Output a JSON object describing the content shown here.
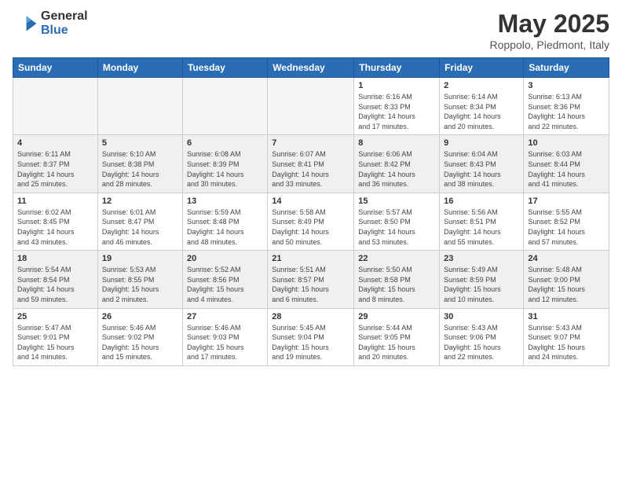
{
  "logo": {
    "general": "General",
    "blue": "Blue"
  },
  "header": {
    "title": "May 2025",
    "subtitle": "Roppolo, Piedmont, Italy"
  },
  "weekdays": [
    "Sunday",
    "Monday",
    "Tuesday",
    "Wednesday",
    "Thursday",
    "Friday",
    "Saturday"
  ],
  "weeks": [
    [
      {
        "day": "",
        "info": ""
      },
      {
        "day": "",
        "info": ""
      },
      {
        "day": "",
        "info": ""
      },
      {
        "day": "",
        "info": ""
      },
      {
        "day": "1",
        "info": "Sunrise: 6:16 AM\nSunset: 8:33 PM\nDaylight: 14 hours\nand 17 minutes."
      },
      {
        "day": "2",
        "info": "Sunrise: 6:14 AM\nSunset: 8:34 PM\nDaylight: 14 hours\nand 20 minutes."
      },
      {
        "day": "3",
        "info": "Sunrise: 6:13 AM\nSunset: 8:36 PM\nDaylight: 14 hours\nand 22 minutes."
      }
    ],
    [
      {
        "day": "4",
        "info": "Sunrise: 6:11 AM\nSunset: 8:37 PM\nDaylight: 14 hours\nand 25 minutes."
      },
      {
        "day": "5",
        "info": "Sunrise: 6:10 AM\nSunset: 8:38 PM\nDaylight: 14 hours\nand 28 minutes."
      },
      {
        "day": "6",
        "info": "Sunrise: 6:08 AM\nSunset: 8:39 PM\nDaylight: 14 hours\nand 30 minutes."
      },
      {
        "day": "7",
        "info": "Sunrise: 6:07 AM\nSunset: 8:41 PM\nDaylight: 14 hours\nand 33 minutes."
      },
      {
        "day": "8",
        "info": "Sunrise: 6:06 AM\nSunset: 8:42 PM\nDaylight: 14 hours\nand 36 minutes."
      },
      {
        "day": "9",
        "info": "Sunrise: 6:04 AM\nSunset: 8:43 PM\nDaylight: 14 hours\nand 38 minutes."
      },
      {
        "day": "10",
        "info": "Sunrise: 6:03 AM\nSunset: 8:44 PM\nDaylight: 14 hours\nand 41 minutes."
      }
    ],
    [
      {
        "day": "11",
        "info": "Sunrise: 6:02 AM\nSunset: 8:45 PM\nDaylight: 14 hours\nand 43 minutes."
      },
      {
        "day": "12",
        "info": "Sunrise: 6:01 AM\nSunset: 8:47 PM\nDaylight: 14 hours\nand 46 minutes."
      },
      {
        "day": "13",
        "info": "Sunrise: 5:59 AM\nSunset: 8:48 PM\nDaylight: 14 hours\nand 48 minutes."
      },
      {
        "day": "14",
        "info": "Sunrise: 5:58 AM\nSunset: 8:49 PM\nDaylight: 14 hours\nand 50 minutes."
      },
      {
        "day": "15",
        "info": "Sunrise: 5:57 AM\nSunset: 8:50 PM\nDaylight: 14 hours\nand 53 minutes."
      },
      {
        "day": "16",
        "info": "Sunrise: 5:56 AM\nSunset: 8:51 PM\nDaylight: 14 hours\nand 55 minutes."
      },
      {
        "day": "17",
        "info": "Sunrise: 5:55 AM\nSunset: 8:52 PM\nDaylight: 14 hours\nand 57 minutes."
      }
    ],
    [
      {
        "day": "18",
        "info": "Sunrise: 5:54 AM\nSunset: 8:54 PM\nDaylight: 14 hours\nand 59 minutes."
      },
      {
        "day": "19",
        "info": "Sunrise: 5:53 AM\nSunset: 8:55 PM\nDaylight: 15 hours\nand 2 minutes."
      },
      {
        "day": "20",
        "info": "Sunrise: 5:52 AM\nSunset: 8:56 PM\nDaylight: 15 hours\nand 4 minutes."
      },
      {
        "day": "21",
        "info": "Sunrise: 5:51 AM\nSunset: 8:57 PM\nDaylight: 15 hours\nand 6 minutes."
      },
      {
        "day": "22",
        "info": "Sunrise: 5:50 AM\nSunset: 8:58 PM\nDaylight: 15 hours\nand 8 minutes."
      },
      {
        "day": "23",
        "info": "Sunrise: 5:49 AM\nSunset: 8:59 PM\nDaylight: 15 hours\nand 10 minutes."
      },
      {
        "day": "24",
        "info": "Sunrise: 5:48 AM\nSunset: 9:00 PM\nDaylight: 15 hours\nand 12 minutes."
      }
    ],
    [
      {
        "day": "25",
        "info": "Sunrise: 5:47 AM\nSunset: 9:01 PM\nDaylight: 15 hours\nand 14 minutes."
      },
      {
        "day": "26",
        "info": "Sunrise: 5:46 AM\nSunset: 9:02 PM\nDaylight: 15 hours\nand 15 minutes."
      },
      {
        "day": "27",
        "info": "Sunrise: 5:46 AM\nSunset: 9:03 PM\nDaylight: 15 hours\nand 17 minutes."
      },
      {
        "day": "28",
        "info": "Sunrise: 5:45 AM\nSunset: 9:04 PM\nDaylight: 15 hours\nand 19 minutes."
      },
      {
        "day": "29",
        "info": "Sunrise: 5:44 AM\nSunset: 9:05 PM\nDaylight: 15 hours\nand 20 minutes."
      },
      {
        "day": "30",
        "info": "Sunrise: 5:43 AM\nSunset: 9:06 PM\nDaylight: 15 hours\nand 22 minutes."
      },
      {
        "day": "31",
        "info": "Sunrise: 5:43 AM\nSunset: 9:07 PM\nDaylight: 15 hours\nand 24 minutes."
      }
    ]
  ]
}
